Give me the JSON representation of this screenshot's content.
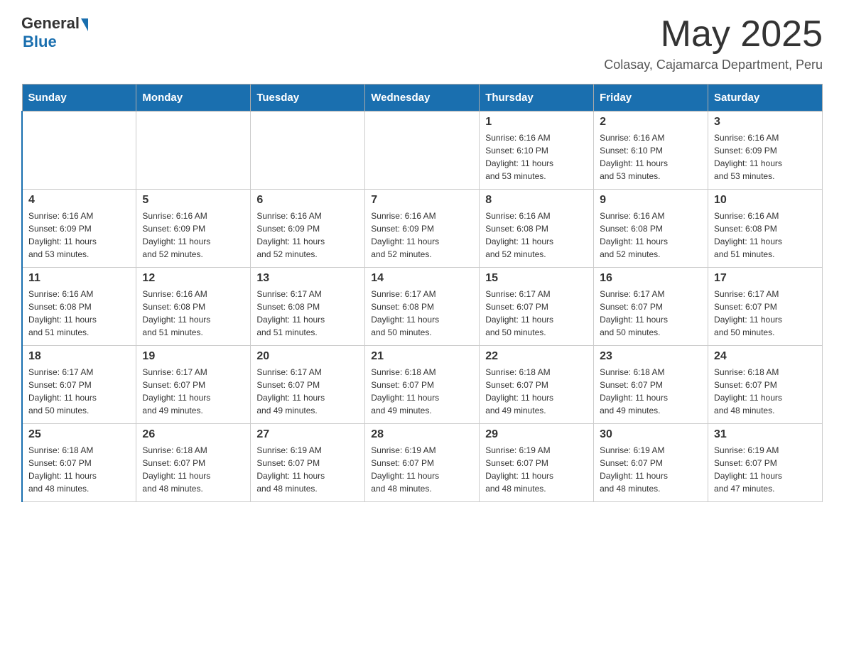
{
  "header": {
    "logo_general": "General",
    "logo_blue": "Blue",
    "month": "May 2025",
    "location": "Colasay, Cajamarca Department, Peru"
  },
  "days_of_week": [
    "Sunday",
    "Monday",
    "Tuesday",
    "Wednesday",
    "Thursday",
    "Friday",
    "Saturday"
  ],
  "weeks": [
    [
      {
        "day": "",
        "info": ""
      },
      {
        "day": "",
        "info": ""
      },
      {
        "day": "",
        "info": ""
      },
      {
        "day": "",
        "info": ""
      },
      {
        "day": "1",
        "info": "Sunrise: 6:16 AM\nSunset: 6:10 PM\nDaylight: 11 hours\nand 53 minutes."
      },
      {
        "day": "2",
        "info": "Sunrise: 6:16 AM\nSunset: 6:10 PM\nDaylight: 11 hours\nand 53 minutes."
      },
      {
        "day": "3",
        "info": "Sunrise: 6:16 AM\nSunset: 6:09 PM\nDaylight: 11 hours\nand 53 minutes."
      }
    ],
    [
      {
        "day": "4",
        "info": "Sunrise: 6:16 AM\nSunset: 6:09 PM\nDaylight: 11 hours\nand 53 minutes."
      },
      {
        "day": "5",
        "info": "Sunrise: 6:16 AM\nSunset: 6:09 PM\nDaylight: 11 hours\nand 52 minutes."
      },
      {
        "day": "6",
        "info": "Sunrise: 6:16 AM\nSunset: 6:09 PM\nDaylight: 11 hours\nand 52 minutes."
      },
      {
        "day": "7",
        "info": "Sunrise: 6:16 AM\nSunset: 6:09 PM\nDaylight: 11 hours\nand 52 minutes."
      },
      {
        "day": "8",
        "info": "Sunrise: 6:16 AM\nSunset: 6:08 PM\nDaylight: 11 hours\nand 52 minutes."
      },
      {
        "day": "9",
        "info": "Sunrise: 6:16 AM\nSunset: 6:08 PM\nDaylight: 11 hours\nand 52 minutes."
      },
      {
        "day": "10",
        "info": "Sunrise: 6:16 AM\nSunset: 6:08 PM\nDaylight: 11 hours\nand 51 minutes."
      }
    ],
    [
      {
        "day": "11",
        "info": "Sunrise: 6:16 AM\nSunset: 6:08 PM\nDaylight: 11 hours\nand 51 minutes."
      },
      {
        "day": "12",
        "info": "Sunrise: 6:16 AM\nSunset: 6:08 PM\nDaylight: 11 hours\nand 51 minutes."
      },
      {
        "day": "13",
        "info": "Sunrise: 6:17 AM\nSunset: 6:08 PM\nDaylight: 11 hours\nand 51 minutes."
      },
      {
        "day": "14",
        "info": "Sunrise: 6:17 AM\nSunset: 6:08 PM\nDaylight: 11 hours\nand 50 minutes."
      },
      {
        "day": "15",
        "info": "Sunrise: 6:17 AM\nSunset: 6:07 PM\nDaylight: 11 hours\nand 50 minutes."
      },
      {
        "day": "16",
        "info": "Sunrise: 6:17 AM\nSunset: 6:07 PM\nDaylight: 11 hours\nand 50 minutes."
      },
      {
        "day": "17",
        "info": "Sunrise: 6:17 AM\nSunset: 6:07 PM\nDaylight: 11 hours\nand 50 minutes."
      }
    ],
    [
      {
        "day": "18",
        "info": "Sunrise: 6:17 AM\nSunset: 6:07 PM\nDaylight: 11 hours\nand 50 minutes."
      },
      {
        "day": "19",
        "info": "Sunrise: 6:17 AM\nSunset: 6:07 PM\nDaylight: 11 hours\nand 49 minutes."
      },
      {
        "day": "20",
        "info": "Sunrise: 6:17 AM\nSunset: 6:07 PM\nDaylight: 11 hours\nand 49 minutes."
      },
      {
        "day": "21",
        "info": "Sunrise: 6:18 AM\nSunset: 6:07 PM\nDaylight: 11 hours\nand 49 minutes."
      },
      {
        "day": "22",
        "info": "Sunrise: 6:18 AM\nSunset: 6:07 PM\nDaylight: 11 hours\nand 49 minutes."
      },
      {
        "day": "23",
        "info": "Sunrise: 6:18 AM\nSunset: 6:07 PM\nDaylight: 11 hours\nand 49 minutes."
      },
      {
        "day": "24",
        "info": "Sunrise: 6:18 AM\nSunset: 6:07 PM\nDaylight: 11 hours\nand 48 minutes."
      }
    ],
    [
      {
        "day": "25",
        "info": "Sunrise: 6:18 AM\nSunset: 6:07 PM\nDaylight: 11 hours\nand 48 minutes."
      },
      {
        "day": "26",
        "info": "Sunrise: 6:18 AM\nSunset: 6:07 PM\nDaylight: 11 hours\nand 48 minutes."
      },
      {
        "day": "27",
        "info": "Sunrise: 6:19 AM\nSunset: 6:07 PM\nDaylight: 11 hours\nand 48 minutes."
      },
      {
        "day": "28",
        "info": "Sunrise: 6:19 AM\nSunset: 6:07 PM\nDaylight: 11 hours\nand 48 minutes."
      },
      {
        "day": "29",
        "info": "Sunrise: 6:19 AM\nSunset: 6:07 PM\nDaylight: 11 hours\nand 48 minutes."
      },
      {
        "day": "30",
        "info": "Sunrise: 6:19 AM\nSunset: 6:07 PM\nDaylight: 11 hours\nand 48 minutes."
      },
      {
        "day": "31",
        "info": "Sunrise: 6:19 AM\nSunset: 6:07 PM\nDaylight: 11 hours\nand 47 minutes."
      }
    ]
  ]
}
